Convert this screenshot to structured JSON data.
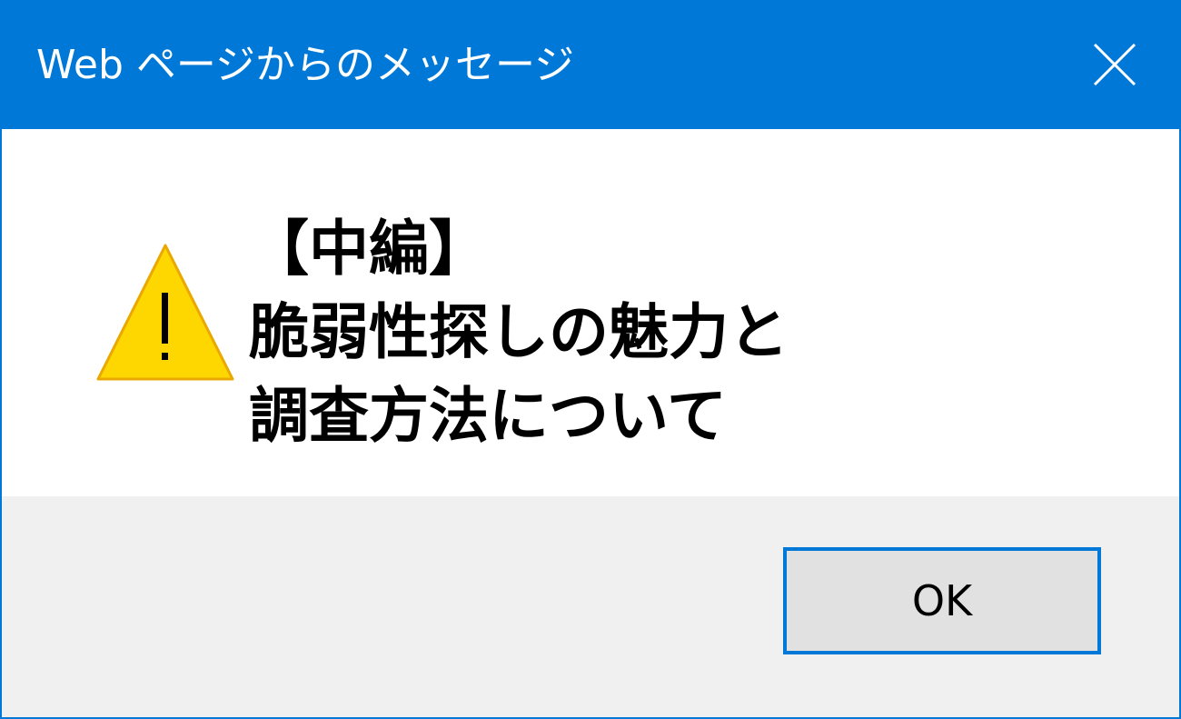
{
  "window": {
    "title": "Web ページからのメッセージ",
    "close_icon": "close-icon",
    "accent_color": "#0078d7"
  },
  "message": {
    "icon": "warning-icon",
    "lines": [
      "【中編】",
      "脆弱性探しの魅力と",
      "調査方法について"
    ]
  },
  "buttons": {
    "ok_label": "OK"
  }
}
